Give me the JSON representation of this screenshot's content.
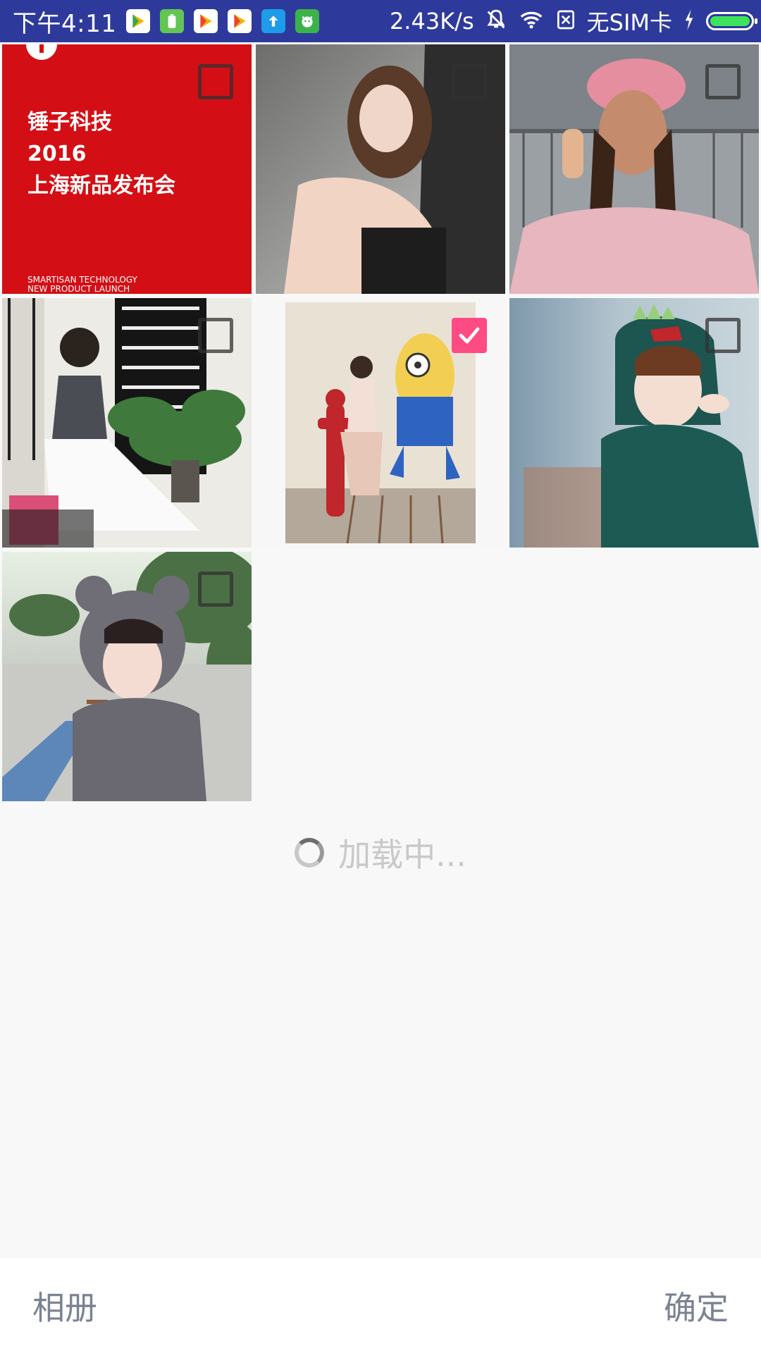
{
  "status_bar": {
    "time": "下午4:11",
    "net_speed": "2.43K/s",
    "sim": "无SIM卡",
    "battery_level": 1.0,
    "app_icons": [
      "play-store-icon",
      "battery-app-icon",
      "play-store-icon",
      "play-store-icon",
      "upload-icon",
      "android-cat-icon"
    ],
    "bg_color": "#2e3a9b"
  },
  "photos": [
    {
      "name": "photo-smartisan-launch",
      "checked": false,
      "title_line1": "锤子科技",
      "title_line2": "2016",
      "title_line3": "上海新品发布会",
      "sub_line1": "SMARTISAN TECHNOLOGY",
      "sub_line2": "NEW PRODUCT LAUNCH"
    },
    {
      "name": "photo-girl-sitting",
      "checked": false
    },
    {
      "name": "photo-girl-pink-cap",
      "checked": false
    },
    {
      "name": "photo-girl-london-poster",
      "checked": false
    },
    {
      "name": "photo-girl-minion-wall",
      "checked": true
    },
    {
      "name": "photo-girl-dino-hoodie",
      "checked": false
    },
    {
      "name": "photo-girl-bear-hood",
      "checked": false
    }
  ],
  "loading": {
    "text": "加载中..."
  },
  "bottom_bar": {
    "album_label": "相册",
    "confirm_label": "确定"
  },
  "colors": {
    "accent": "#ff4b84",
    "label": "#7b8292"
  }
}
